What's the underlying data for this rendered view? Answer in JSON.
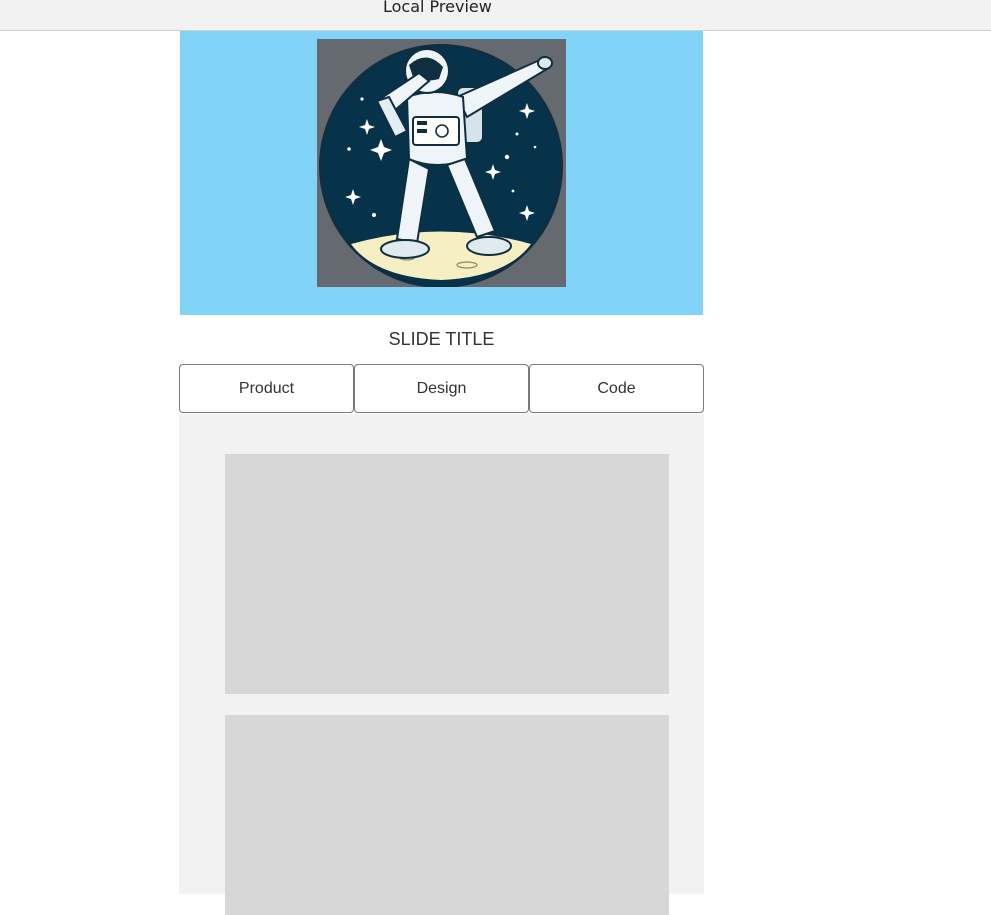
{
  "window": {
    "title": "Local Preview"
  },
  "hero": {
    "image_name": "astronaut-dab-illustration",
    "background_color": "#81d3f8"
  },
  "slide": {
    "title": "SLIDE TITLE"
  },
  "tabs": [
    {
      "label": "Product"
    },
    {
      "label": "Design"
    },
    {
      "label": "Code"
    }
  ],
  "content": {
    "cards": [
      {
        "name": "placeholder-card-1"
      },
      {
        "name": "placeholder-card-2"
      }
    ]
  }
}
